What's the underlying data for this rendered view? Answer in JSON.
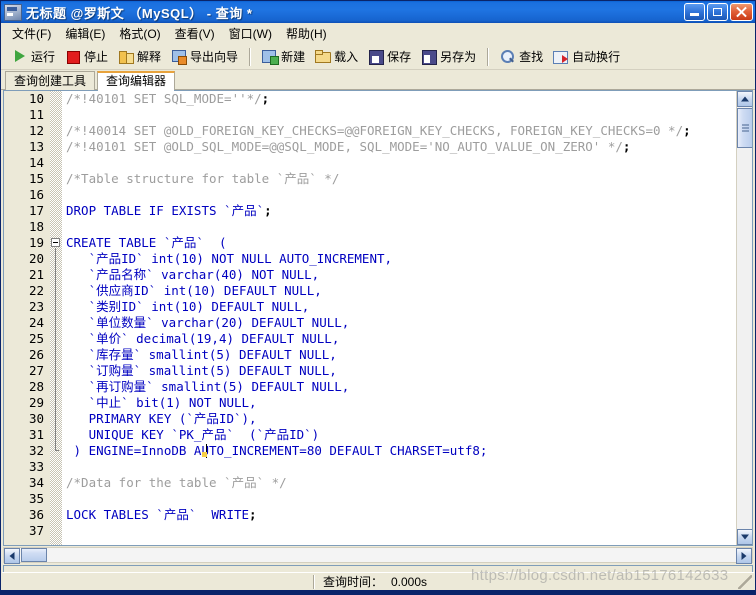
{
  "window": {
    "title": "无标题 @罗斯文 （MySQL） - 查询 *",
    "icon": "query-window-icon",
    "controls": {
      "minimize": "最小化",
      "maximize": "最大化",
      "close": "关闭"
    }
  },
  "menubar": {
    "items": [
      {
        "label": "文件(F)",
        "name": "menu-file"
      },
      {
        "label": "编辑(E)",
        "name": "menu-edit"
      },
      {
        "label": "格式(O)",
        "name": "menu-format"
      },
      {
        "label": "查看(V)",
        "name": "menu-view"
      },
      {
        "label": "窗口(W)",
        "name": "menu-window"
      },
      {
        "label": "帮助(H)",
        "name": "menu-help"
      }
    ]
  },
  "toolbar": {
    "buttons": [
      {
        "label": "运行",
        "icon": "run-icon",
        "name": "run"
      },
      {
        "label": "停止",
        "icon": "stop-icon",
        "name": "stop"
      },
      {
        "label": "解释",
        "icon": "explain-icon",
        "name": "explain"
      },
      {
        "label": "导出向导",
        "icon": "export-icon",
        "name": "export-wizard"
      },
      {
        "label": "新建",
        "icon": "new-icon",
        "name": "new"
      },
      {
        "label": "载入",
        "icon": "folder-open-icon",
        "name": "load"
      },
      {
        "label": "保存",
        "icon": "save-icon",
        "name": "save"
      },
      {
        "label": "另存为",
        "icon": "save-as-icon",
        "name": "save-as"
      },
      {
        "label": "查找",
        "icon": "search-icon",
        "name": "find"
      },
      {
        "label": "自动换行",
        "icon": "word-wrap-icon",
        "name": "word-wrap"
      }
    ]
  },
  "tabs": [
    {
      "label": "查询创建工具",
      "active": false,
      "name": "tab-query-builder"
    },
    {
      "label": "查询编辑器",
      "active": true,
      "name": "tab-query-editor"
    }
  ],
  "editor": {
    "first_visible_line": 10,
    "last_visible_line": 37,
    "fold_start_line": 19,
    "fold_end_line": 32,
    "caret_line": 32,
    "caret_col_text": "InnoDB",
    "lines": [
      {
        "n": 10,
        "tokens": [
          {
            "t": "/*!40101 SET SQL_MODE=''*/",
            "c": "com"
          },
          {
            "t": ";",
            "c": "pun"
          }
        ]
      },
      {
        "n": 11,
        "tokens": []
      },
      {
        "n": 12,
        "tokens": [
          {
            "t": "/*!40014 SET @OLD_FOREIGN_KEY_CHECKS=@@FOREIGN_KEY_CHECKS, FOREIGN_KEY_CHECKS=0 */",
            "c": "com"
          },
          {
            "t": ";",
            "c": "pun"
          }
        ]
      },
      {
        "n": 13,
        "tokens": [
          {
            "t": "/*!40101 SET @OLD_SQL_MODE=@@SQL_MODE, SQL_MODE='NO_AUTO_VALUE_ON_ZERO' */",
            "c": "com"
          },
          {
            "t": ";",
            "c": "pun"
          }
        ]
      },
      {
        "n": 14,
        "tokens": []
      },
      {
        "n": 15,
        "tokens": [
          {
            "t": "/*Table structure for table `产品` */",
            "c": "com"
          }
        ]
      },
      {
        "n": 16,
        "tokens": []
      },
      {
        "n": 17,
        "tokens": [
          {
            "t": "DROP TABLE IF EXISTS ",
            "c": "kw"
          },
          {
            "t": "`产品`",
            "c": "kw"
          },
          {
            "t": ";",
            "c": "pun"
          }
        ]
      },
      {
        "n": 18,
        "tokens": []
      },
      {
        "n": 19,
        "tokens": [
          {
            "t": "CREATE TABLE ",
            "c": "kw"
          },
          {
            "t": "`产品`",
            "c": "kw"
          },
          {
            "t": "  (",
            "c": "kw"
          }
        ]
      },
      {
        "n": 20,
        "tokens": [
          {
            "t": "   `产品ID` ",
            "c": "kw"
          },
          {
            "t": "int(10) NOT NULL AUTO_INCREMENT,",
            "c": "kw"
          }
        ]
      },
      {
        "n": 21,
        "tokens": [
          {
            "t": "   `产品名称` ",
            "c": "kw"
          },
          {
            "t": "varchar(40) NOT NULL,",
            "c": "kw"
          }
        ]
      },
      {
        "n": 22,
        "tokens": [
          {
            "t": "   `供应商ID` ",
            "c": "kw"
          },
          {
            "t": "int(10) DEFAULT NULL,",
            "c": "kw"
          }
        ]
      },
      {
        "n": 23,
        "tokens": [
          {
            "t": "   `类别ID` ",
            "c": "kw"
          },
          {
            "t": "int(10) DEFAULT NULL,",
            "c": "kw"
          }
        ]
      },
      {
        "n": 24,
        "tokens": [
          {
            "t": "   `单位数量` ",
            "c": "kw"
          },
          {
            "t": "varchar(20) DEFAULT NULL,",
            "c": "kw"
          }
        ]
      },
      {
        "n": 25,
        "tokens": [
          {
            "t": "   `单价` ",
            "c": "kw"
          },
          {
            "t": "decimal(19,4) DEFAULT NULL,",
            "c": "kw"
          }
        ]
      },
      {
        "n": 26,
        "tokens": [
          {
            "t": "   `库存量` ",
            "c": "kw"
          },
          {
            "t": "smallint(5) DEFAULT NULL,",
            "c": "kw"
          }
        ]
      },
      {
        "n": 27,
        "tokens": [
          {
            "t": "   `订购量` ",
            "c": "kw"
          },
          {
            "t": "smallint(5) DEFAULT NULL,",
            "c": "kw"
          }
        ]
      },
      {
        "n": 28,
        "tokens": [
          {
            "t": "   `再订购量` ",
            "c": "kw"
          },
          {
            "t": "smallint(5) DEFAULT NULL,",
            "c": "kw"
          }
        ]
      },
      {
        "n": 29,
        "tokens": [
          {
            "t": "   `中止` ",
            "c": "kw"
          },
          {
            "t": "bit(1) NOT NULL,",
            "c": "kw"
          }
        ]
      },
      {
        "n": 30,
        "tokens": [
          {
            "t": "   PRIMARY KEY (`产品ID`),",
            "c": "kw"
          }
        ]
      },
      {
        "n": 31,
        "tokens": [
          {
            "t": "   UNIQUE KEY `PK_产品`  (`产品ID`)",
            "c": "kw"
          }
        ]
      },
      {
        "n": 32,
        "tokens": [
          {
            "t": " ) ENGINE=InnoDB AUTO_INCREMENT=80 DEFAULT CHARSET=utf8;",
            "c": "kw"
          }
        ]
      },
      {
        "n": 33,
        "tokens": []
      },
      {
        "n": 34,
        "tokens": [
          {
            "t": "/*Data for the table `产品` */",
            "c": "com"
          }
        ]
      },
      {
        "n": 35,
        "tokens": []
      },
      {
        "n": 36,
        "tokens": [
          {
            "t": "LOCK TABLES `产品`  WRITE",
            "c": "kw"
          },
          {
            "t": ";",
            "c": "pun"
          }
        ]
      },
      {
        "n": 37,
        "tokens": []
      }
    ]
  },
  "statusbar": {
    "query_time_label": "查询时间：",
    "query_time_value": "0.000s"
  },
  "watermark": "https://blog.csdn.net/ab15176142633",
  "colors": {
    "titlebar": "#1f74e2",
    "chrome": "#ece9d8",
    "keyword": "#0000c0",
    "comment": "#9d9d9d",
    "tab_active_accent": "#e8a33d",
    "editor_bg": "#ffffff"
  }
}
